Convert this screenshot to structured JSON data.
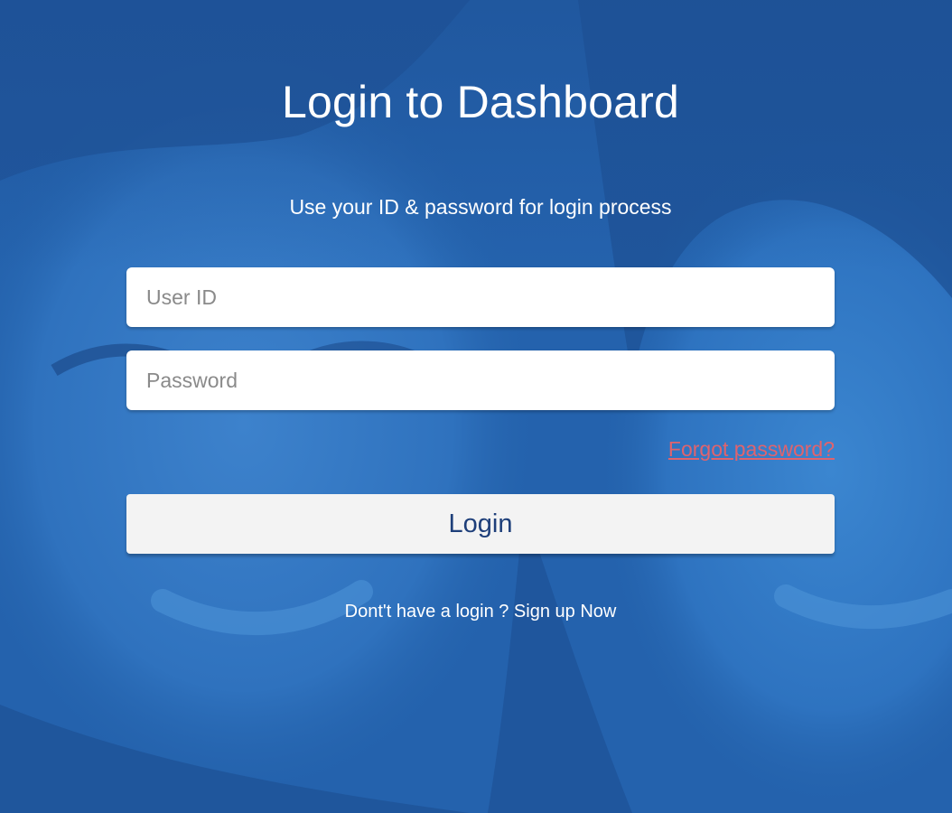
{
  "page": {
    "title": "Login to Dashboard",
    "subtitle": "Use your ID & password for login process"
  },
  "form": {
    "user_id": {
      "value": "",
      "placeholder": "User ID"
    },
    "password": {
      "value": "",
      "placeholder": "Password"
    },
    "forgot_password_label": "Forgot password?",
    "login_label": "Login"
  },
  "footer": {
    "signup_text": "Dont't have a login ? Sign up Now"
  },
  "colors": {
    "background": "#2160ab",
    "forgot_link": "#e0636d",
    "login_text": "#1e3f7a"
  }
}
